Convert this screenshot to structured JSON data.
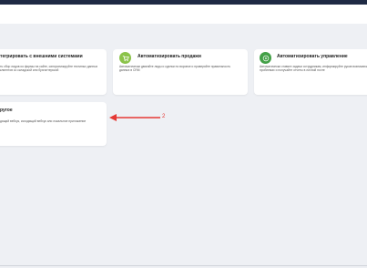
{
  "cards": [
    {
      "title": "тегрировать с внешними системами",
      "desc": "ть сбор лидов из формы на сайте, синхронизируйте тектиных данных клиентов со складской или бухгалтерской",
      "icon": "none"
    },
    {
      "title": "Автоматизировать продажи",
      "desc": "Автоматически двигайте лиды и сделки по воронке и проверяйте правильность данных в CRM",
      "icon": "cart-icon",
      "icon_color": "#8bc34a"
    },
    {
      "title": "Автоматизировать управление",
      "desc": "Автоматически ставьте задачи сотрудникам, информируйте руков возникающих проблемах и получайте отчеты в личной почте",
      "icon": "play-icon",
      "icon_color": "#43a047"
    },
    {
      "title": "ругое",
      "desc": "дящий вебхук, исходящий вебхук или локальное приложение",
      "icon": "none"
    }
  ],
  "annotation": {
    "label": "2",
    "color": "#e53935"
  }
}
